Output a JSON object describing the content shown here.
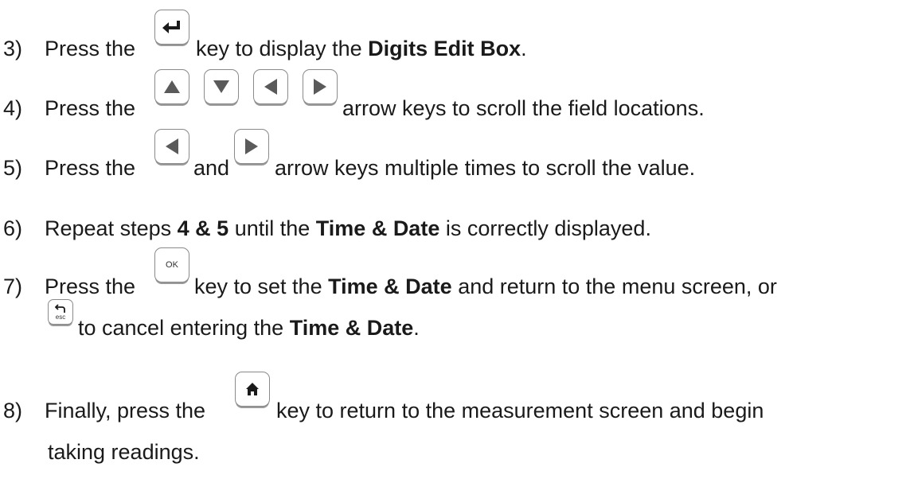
{
  "steps": [
    {
      "number": "3)",
      "before_key": "Press the",
      "key_icon": "enter-icon",
      "after_key_plain": "key to display the",
      "after_key_bold": "Digits Edit Box",
      "after_key_tail": "."
    },
    {
      "number": "4)",
      "before_key": "Press the",
      "key_icons": [
        "arrow-up-icon",
        "arrow-down-icon",
        "arrow-left-icon",
        "arrow-right-icon"
      ],
      "after_keys": "arrow keys to scroll the field locations."
    },
    {
      "number": "5)",
      "before_key": "Press the",
      "key_icons": [
        "arrow-left-icon",
        "arrow-right-icon"
      ],
      "between_keys": "and",
      "after_keys": "arrow keys multiple times to scroll the value."
    },
    {
      "number": "6)",
      "part1": "Repeat steps",
      "bold1": "4 & 5",
      "part2": "until the",
      "bold2": "Time & Date",
      "part3": "is correctly displayed."
    },
    {
      "number": "7)",
      "before_key": "Press the",
      "key_label": "OK",
      "after_key_plain": "key to set the",
      "after_key_bold": "Time & Date",
      "after_key_tail": "and return to the menu screen, or",
      "line2_key_label": "esc",
      "line2_plain": "to cancel entering the",
      "line2_bold": "Time & Date",
      "line2_tail": "."
    },
    {
      "number": "8)",
      "before_key": "Finally, press the",
      "key_icon": "home-icon",
      "after_key": "key to return to the measurement screen and begin",
      "line2": "taking readings."
    }
  ],
  "colors": {
    "text": "#1a1a1a",
    "key_border": "#8a8a8a",
    "icon": "#1a1a1a"
  }
}
